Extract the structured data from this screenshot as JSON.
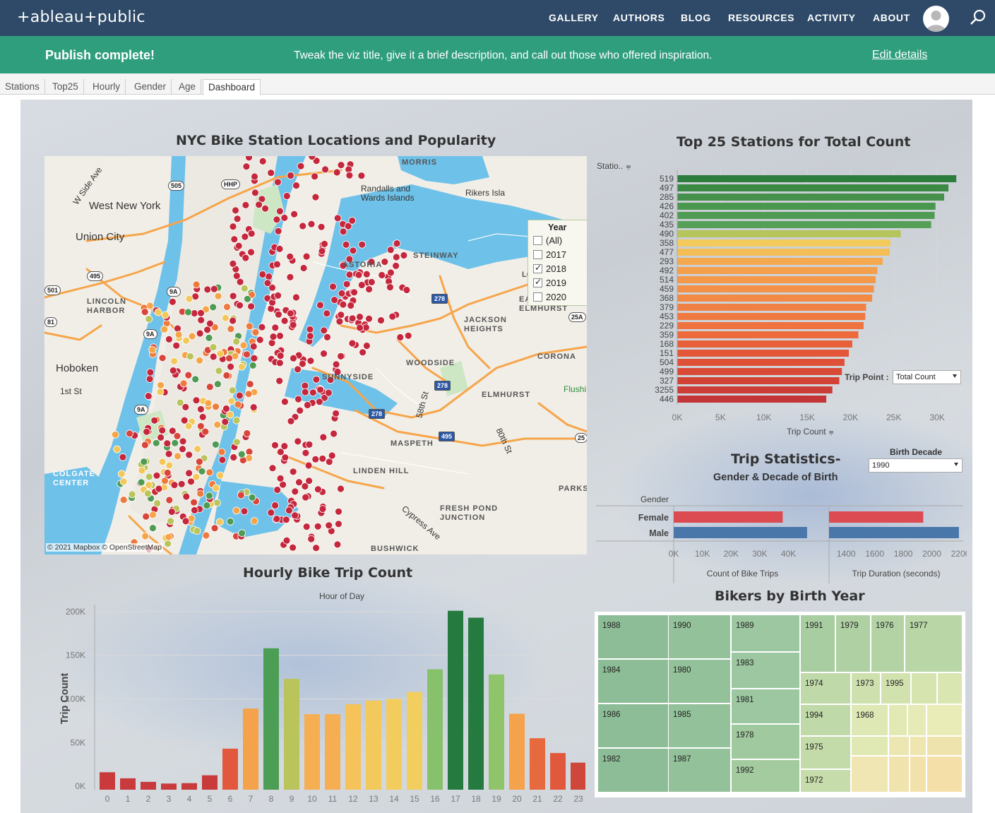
{
  "nav": {
    "logo": "+ableau+public",
    "links": [
      "GALLERY",
      "AUTHORS",
      "BLOG",
      "RESOURCES",
      "ACTIVITY",
      "ABOUT"
    ]
  },
  "publish": {
    "title": "Publish complete!",
    "message": "Tweak the viz title, give it a brief description, and call out those who offered inspiration.",
    "edit": "Edit details"
  },
  "tabs": [
    "Stations",
    "Top25",
    "Hourly",
    "Gender",
    "Age",
    "Dashboard"
  ],
  "map_panel": {
    "title": "NYC Bike Station Locations and Popularity",
    "attribution": "© 2021 Mapbox  © OpenStreetMap",
    "legend": {
      "title": "Year",
      "items": [
        {
          "label": "(All)",
          "checked": false
        },
        {
          "label": "2017",
          "checked": false
        },
        {
          "label": "2018",
          "checked": true
        },
        {
          "label": "2019",
          "checked": true
        },
        {
          "label": "2020",
          "checked": false
        }
      ]
    },
    "places": [
      "MORRIS",
      "Randalls and Wards Islands",
      "Rikers Isla",
      "West New York",
      "Union City",
      "STEINWAY",
      "ASTORIA",
      "LGA",
      "EAST ELMHURST",
      "JACKSON HEIGHTS",
      "LINCOLN HARBOR",
      "Hoboken",
      "WOODSIDE",
      "CORONA",
      "SUNNYSIDE",
      "ELMHURST",
      "MASPETH",
      "LINDEN HILL",
      "FRESH POND JUNCTION",
      "PARKS",
      "BUSHWICK",
      "COLGATE CENTER",
      "1st St",
      "W Side Ave",
      "58th St",
      "80th St",
      "Cypress Ave",
      "Flushi"
    ],
    "shields": [
      "505",
      "495",
      "501",
      "81",
      "9A",
      "9A",
      "9A",
      "278",
      "278",
      "278",
      "495",
      "25A",
      "25",
      "HHP"
    ]
  },
  "top25": {
    "title": "Top 25 Stations for Total Count",
    "row_header": "Statio..",
    "x_title": "Trip Count",
    "trip_point_label": "Trip Point :",
    "trip_point_value": "Total Count",
    "chart_data": {
      "type": "bar",
      "orientation": "horizontal",
      "categories": [
        "519",
        "497",
        "285",
        "426",
        "402",
        "435",
        "490",
        "358",
        "477",
        "293",
        "492",
        "514",
        "459",
        "368",
        "379",
        "453",
        "229",
        "359",
        "168",
        "151",
        "504",
        "499",
        "327",
        "3255",
        "446"
      ],
      "values": [
        32200,
        31300,
        30800,
        29800,
        29700,
        29300,
        25800,
        24600,
        24500,
        23700,
        23100,
        22900,
        22700,
        22500,
        21800,
        21700,
        21500,
        20900,
        20200,
        19800,
        19300,
        19000,
        18700,
        17900,
        17200
      ],
      "colors": [
        "#2d7d3d",
        "#3a8a43",
        "#45904a",
        "#4a9750",
        "#4f9b53",
        "#55a056",
        "#b5c45b",
        "#f2cb5c",
        "#f4be57",
        "#f5a94f",
        "#f49f4c",
        "#f4984a",
        "#f39148",
        "#f28a46",
        "#f08044",
        "#ef7941",
        "#ee733f",
        "#ec6a3c",
        "#e7603a",
        "#e35738",
        "#df5136",
        "#d94a36",
        "#d24336",
        "#cc3d37",
        "#c43538"
      ],
      "ticks": [
        "0K",
        "5K",
        "10K",
        "15K",
        "20K",
        "25K",
        "30K"
      ],
      "xlim": [
        0,
        33000
      ]
    }
  },
  "stats": {
    "title": "Trip Statistics-",
    "subtitle": "Gender & Decade of Birth",
    "birth_label": "Birth Decade",
    "birth_value": "1990",
    "gender_header": "Gender",
    "rows": [
      "Female",
      "Male"
    ],
    "chart_data": [
      {
        "type": "bar",
        "orientation": "horizontal",
        "categories": [
          "Female",
          "Male"
        ],
        "values": [
          38000,
          46500
        ],
        "xlim": [
          0,
          48000
        ],
        "ticks": [
          "0K",
          "10K",
          "20K",
          "30K",
          "40K"
        ],
        "xlabel": "Count of Bike Trips"
      },
      {
        "type": "bar",
        "orientation": "horizontal",
        "categories": [
          "Female",
          "Male"
        ],
        "values": [
          1940,
          2190
        ],
        "xlim": [
          1280,
          2220
        ],
        "ticks": [
          "1400",
          "1600",
          "1800",
          "2000",
          "2200"
        ],
        "xlabel": "Trip Duration (seconds)"
      }
    ]
  },
  "hourly": {
    "title": "Hourly Bike Trip Count",
    "x_title": "Hour of Day",
    "y_title": "Trip Count",
    "chart_data": {
      "type": "bar",
      "categories": [
        "0",
        "1",
        "2",
        "3",
        "4",
        "5",
        "6",
        "7",
        "8",
        "9",
        "10",
        "11",
        "12",
        "13",
        "14",
        "15",
        "16",
        "17",
        "18",
        "19",
        "20",
        "21",
        "22",
        "23"
      ],
      "values": [
        16000,
        9000,
        5000,
        3000,
        3500,
        12500,
        43000,
        89000,
        158000,
        123000,
        82500,
        82500,
        94000,
        98000,
        100000,
        108000,
        134000,
        201000,
        193000,
        128000,
        83000,
        55000,
        38000,
        27000
      ],
      "colors": [
        "#c93a3d",
        "#c93a3d",
        "#c93a3d",
        "#c93a3d",
        "#c93a3d",
        "#c93a3d",
        "#e1583c",
        "#f5a24c",
        "#4c9e55",
        "#b9c45b",
        "#f5ae52",
        "#f5ae52",
        "#f5c35a",
        "#f4c95c",
        "#f3cc5e",
        "#f2ce5e",
        "#88c16b",
        "#257a3f",
        "#257a3f",
        "#8fc46b",
        "#f5a24c",
        "#e66a3e",
        "#e1583c",
        "#cf463b"
      ],
      "ticks": [
        "0K",
        "50K",
        "100K",
        "150K",
        "200K"
      ],
      "ylim": [
        -4000,
        208000
      ]
    }
  },
  "birth": {
    "title": "Bikers by Birth Year",
    "chart_data": {
      "type": "treemap",
      "labels": [
        "1988",
        "1990",
        "1989",
        "1991",
        "1979",
        "1976",
        "1977",
        "1984",
        "1980",
        "1983",
        "1974",
        "1973",
        "1995",
        "1981",
        "1986",
        "1985",
        "1994",
        "1968",
        "1978",
        "1975",
        "1982",
        "1987",
        "1992",
        "1972"
      ]
    }
  }
}
